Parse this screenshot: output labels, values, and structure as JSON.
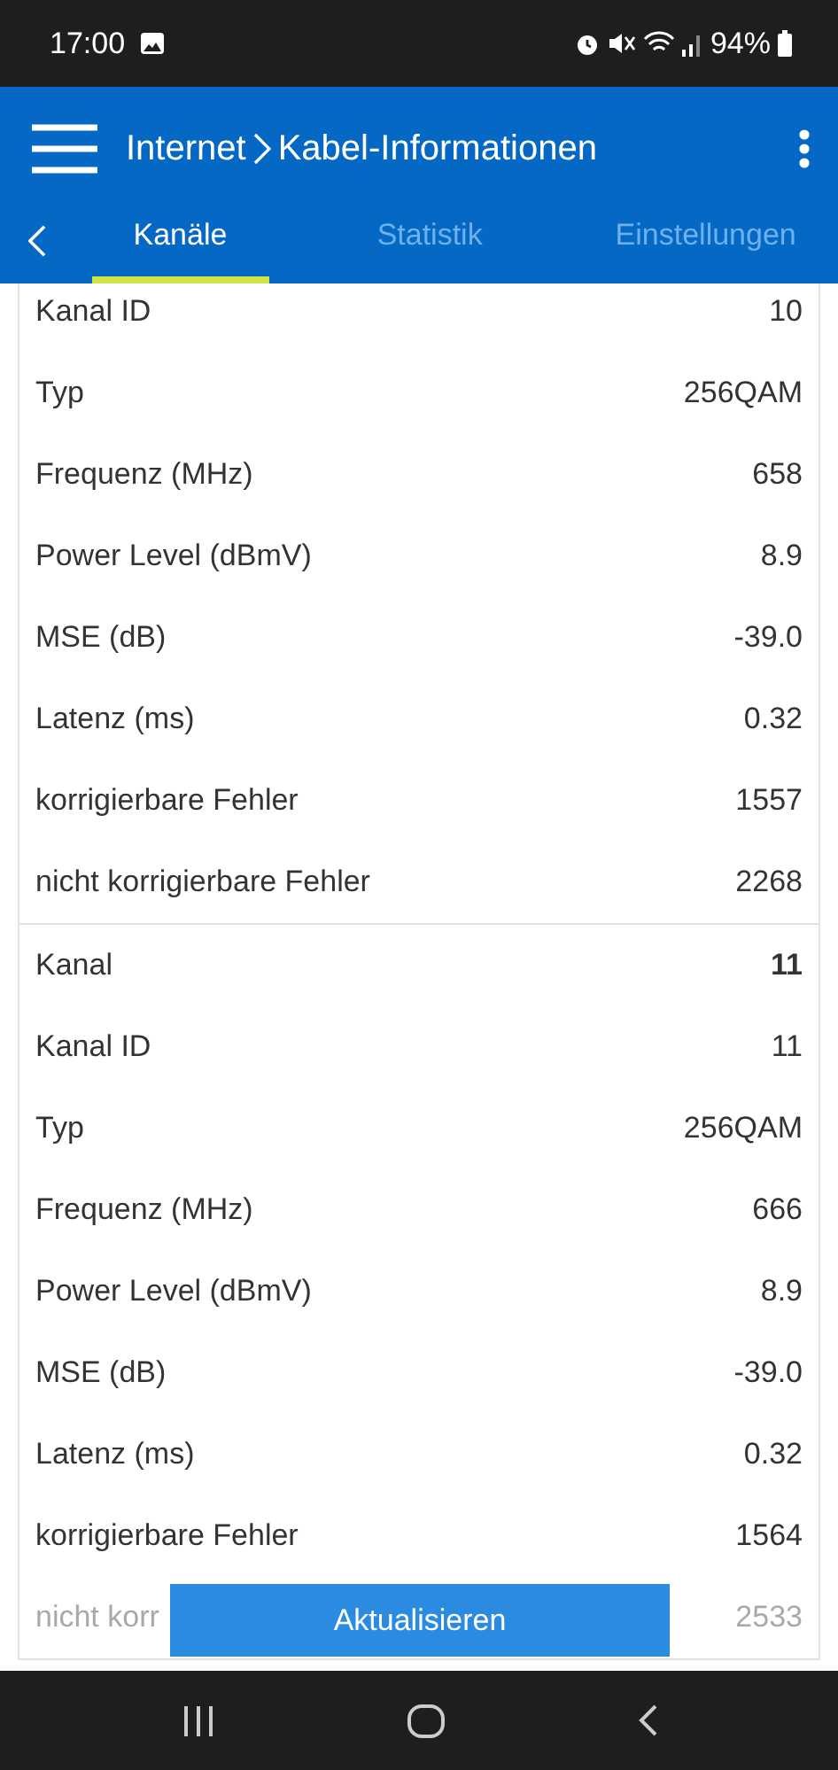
{
  "status_bar": {
    "time": "17:00",
    "battery": "94%"
  },
  "header": {
    "crumbs": [
      "Internet",
      "Kabel-Informationen"
    ]
  },
  "tabs": [
    {
      "label": "Kanäle",
      "selected": true
    },
    {
      "label": "Statistik",
      "selected": false
    },
    {
      "label": "Einstellungen",
      "selected": false
    }
  ],
  "groups": [
    {
      "rows": [
        {
          "label": "Kanal ID",
          "value": "10",
          "bold": false,
          "faded": false
        },
        {
          "label": "Typ",
          "value": "256QAM",
          "bold": false,
          "faded": false
        },
        {
          "label": "Frequenz (MHz)",
          "value": "658",
          "bold": false,
          "faded": false
        },
        {
          "label": "Power Level (dBmV)",
          "value": "8.9",
          "bold": false,
          "faded": false
        },
        {
          "label": "MSE (dB)",
          "value": "-39.0",
          "bold": false,
          "faded": false
        },
        {
          "label": "Latenz (ms)",
          "value": "0.32",
          "bold": false,
          "faded": false
        },
        {
          "label": "korrigierbare Fehler",
          "value": "1557",
          "bold": false,
          "faded": false
        },
        {
          "label": "nicht korrigierbare Fehler",
          "value": "2268",
          "bold": false,
          "faded": false
        }
      ]
    },
    {
      "rows": [
        {
          "label": "Kanal",
          "value": "11",
          "bold": true,
          "faded": false
        },
        {
          "label": "Kanal ID",
          "value": "11",
          "bold": false,
          "faded": false
        },
        {
          "label": "Typ",
          "value": "256QAM",
          "bold": false,
          "faded": false
        },
        {
          "label": "Frequenz (MHz)",
          "value": "666",
          "bold": false,
          "faded": false
        },
        {
          "label": "Power Level (dBmV)",
          "value": "8.9",
          "bold": false,
          "faded": false
        },
        {
          "label": "MSE (dB)",
          "value": "-39.0",
          "bold": false,
          "faded": false
        },
        {
          "label": "Latenz (ms)",
          "value": "0.32",
          "bold": false,
          "faded": false
        },
        {
          "label": "korrigierbare Fehler",
          "value": "1564",
          "bold": false,
          "faded": false
        },
        {
          "label": "nicht korr",
          "value": "2533",
          "bold": false,
          "faded": true
        }
      ]
    }
  ],
  "refresh_button": "Aktualisieren"
}
